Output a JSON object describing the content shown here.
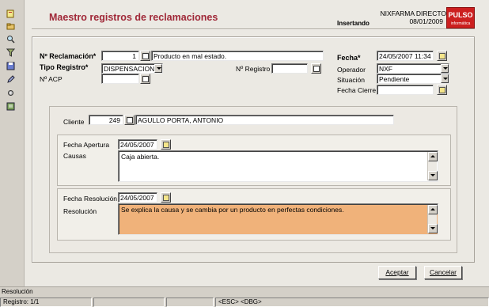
{
  "header": {
    "title": "Maestro registros de reclamaciones",
    "company": "NIXFARMA DIRECTO",
    "date": "08/01/2009",
    "mode": "Insertando",
    "logo_text": "PULSO",
    "logo_subtext": "informática"
  },
  "toolbar": {
    "icons": [
      "new-document-icon",
      "open-folder-icon",
      "search-icon",
      "filter-icon",
      "save-icon",
      "edit-pencil-icon",
      "tools-icon",
      "list-icon"
    ]
  },
  "form": {
    "reclamacion_label": "Nº Reclamación*",
    "reclamacion_value": "1",
    "reclamacion_desc": "Producto en mal estado.",
    "tipo_label": "Tipo Registro*",
    "tipo_value": "DISPENSACION",
    "nregistro_label": "Nº Registro",
    "nregistro_value": "",
    "nacp_label": "Nº ACP",
    "nacp_value": "",
    "fecha_label": "Fecha*",
    "fecha_value": "24/05/2007 11:34",
    "operador_label": "Operador",
    "operador_value": "NXF",
    "situacion_label": "Situación",
    "situacion_value": "Pendiente",
    "fecha_cierre_label": "Fecha Cierre",
    "fecha_cierre_value": ""
  },
  "client": {
    "label": "Cliente",
    "code": "249",
    "name": "AGULLO PORTA, ANTONIO"
  },
  "apertura": {
    "fecha_label": "Fecha Apertura",
    "fecha_value": "24/05/2007",
    "causas_label": "Causas",
    "causas_value": "Caja abierta."
  },
  "resolucion": {
    "fecha_label": "Fecha Resolución",
    "fecha_value": "24/05/2007",
    "label": "Resolución",
    "value": "Se explica la causa y se cambia por un producto en perfectas condiciones."
  },
  "buttons": {
    "accept": "Aceptar",
    "cancel": "Cancelar"
  },
  "statusbar": {
    "field": "Resolución",
    "registro": "Registro: 1/1",
    "keys": "<ESC> <DBG>"
  }
}
